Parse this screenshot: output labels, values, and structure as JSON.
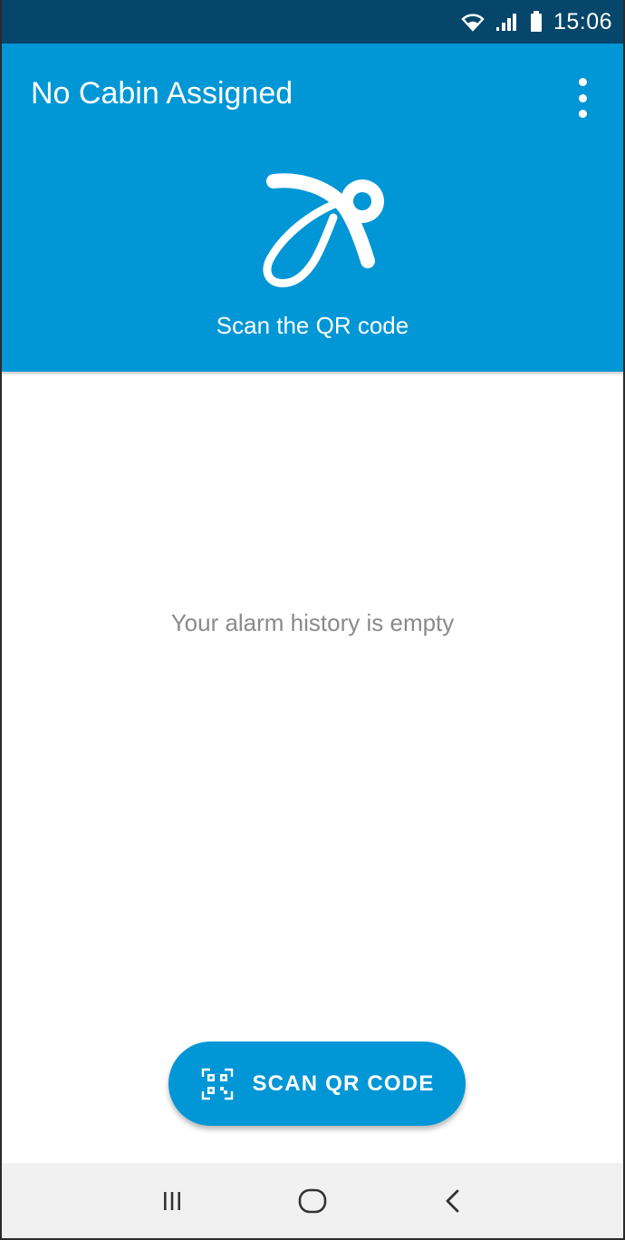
{
  "status_bar": {
    "time": "15:06",
    "icons": [
      "wifi-icon",
      "signal-icon",
      "battery-icon"
    ]
  },
  "header": {
    "title": "No Cabin Assigned",
    "menu_icon": "more-vert-icon",
    "logo_icon": "pacifier-icon",
    "scan_hint": "Scan the QR code"
  },
  "main": {
    "empty_message": "Your alarm history is empty"
  },
  "fab": {
    "icon": "qr-code-icon",
    "label": "SCAN QR CODE"
  },
  "nav_bar": {
    "buttons": [
      "recent-apps-icon",
      "home-icon",
      "back-icon"
    ]
  },
  "colors": {
    "status_bar": "#05466a",
    "primary": "#0196d5",
    "empty_text": "#8a8a8a",
    "nav_bar": "#f1f1f1"
  }
}
